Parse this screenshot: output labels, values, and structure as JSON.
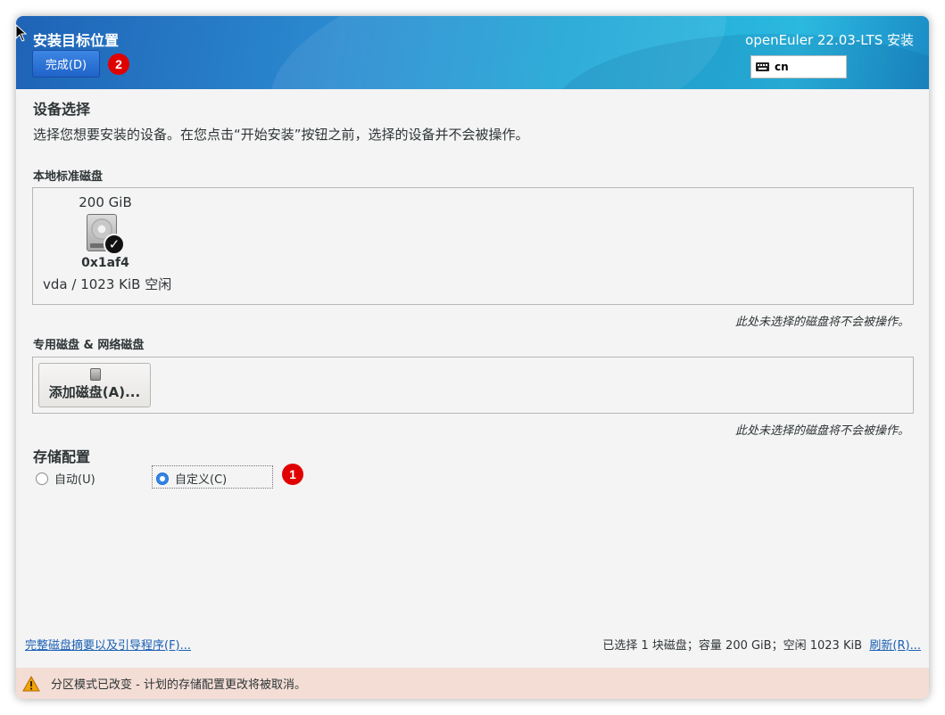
{
  "header": {
    "spoke_title": "安装目标位置",
    "done_label": "完成(D)",
    "product_title": "openEuler 22.03-LTS 安装",
    "keyboard_layout": "cn",
    "annotation_done": "2"
  },
  "device_selection": {
    "title": "设备选择",
    "description": "选择您想要安装的设备。在您点击“开始安装”按钮之前，选择的设备并不会被操作。"
  },
  "local_disks": {
    "title": "本地标准磁盘",
    "disks": [
      {
        "size": "200 GiB",
        "name": "0x1af4",
        "device": "vda",
        "separator": "/",
        "free": "1023 KiB 空闲",
        "selected": true,
        "icon": "harddisk-icon"
      }
    ],
    "note": "此处未选择的磁盘将不会被操作。"
  },
  "special_disks": {
    "title": "专用磁盘 & 网络磁盘",
    "add_label": "添加磁盘(A)...",
    "note": "此处未选择的磁盘将不会被操作。"
  },
  "storage_config": {
    "title": "存储配置",
    "options": [
      {
        "label": "自动(U)",
        "checked": false
      },
      {
        "label": "自定义(C)",
        "checked": true
      }
    ],
    "annotation_custom": "1"
  },
  "footer": {
    "summary_link": "完整磁盘摘要以及引导程序(F)...",
    "status": "已选择 1 块磁盘；容量 200 GiB；空闲 1023 KiB",
    "refresh_link": "刷新(R)...",
    "warning": "分区模式已改变 - 计划的存储配置更改将被取消。"
  },
  "colors": {
    "accent": "#3584e4",
    "badge": "#e00000",
    "warning_bg": "#f3ddd5",
    "link": "#1a5fb4"
  }
}
